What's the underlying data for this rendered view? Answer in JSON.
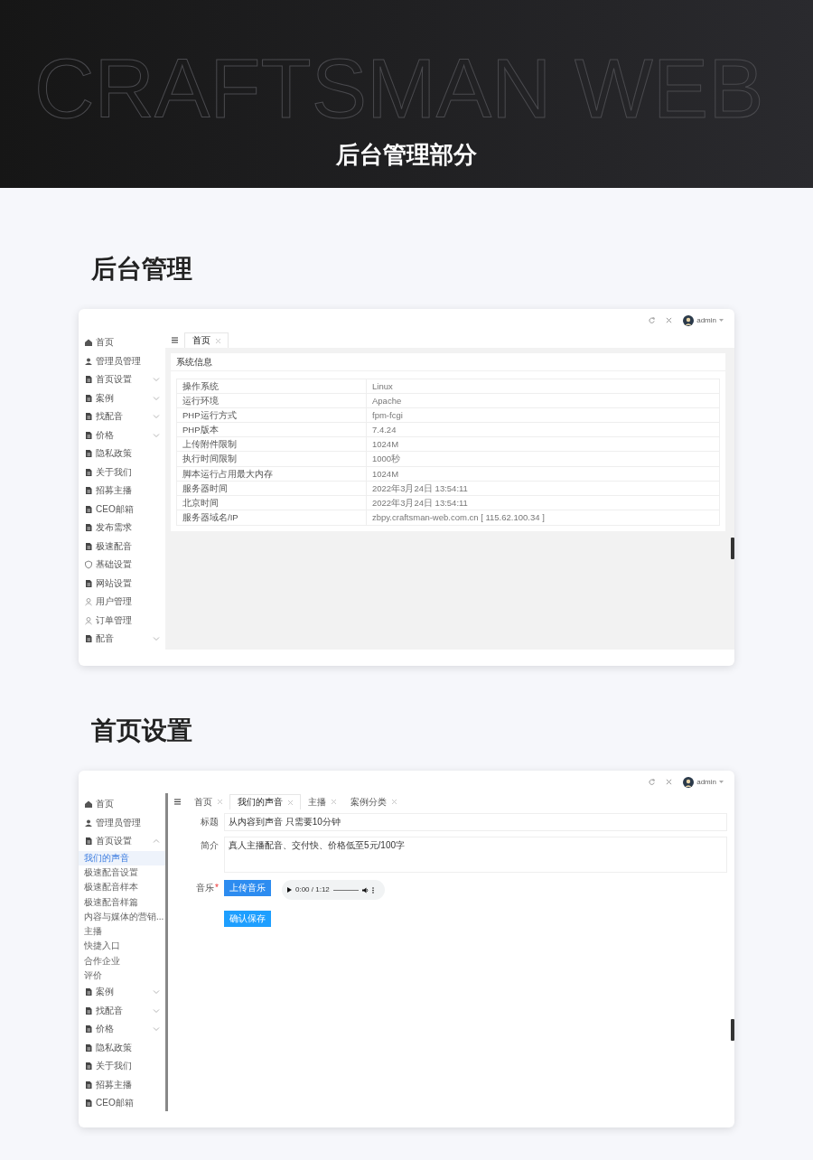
{
  "banner": {
    "backdrop_text": "CRAFTSMAN WEB",
    "title": "后台管理部分"
  },
  "sections": [
    {
      "kind": "info",
      "heading": "后台管理",
      "user": "admin",
      "tabs": [
        {
          "label": "首页",
          "selected": true
        }
      ],
      "sidebar": [
        {
          "label": "首页",
          "kind": "home"
        },
        {
          "label": "管理员管理",
          "kind": "users"
        },
        {
          "label": "首页设置",
          "kind": "file",
          "expanded": false
        },
        {
          "label": "案例",
          "kind": "file",
          "expanded": false
        },
        {
          "label": "找配音",
          "kind": "file",
          "expanded": false
        },
        {
          "label": "价格",
          "kind": "file",
          "expanded": false
        },
        {
          "label": "隐私政策",
          "kind": "file"
        },
        {
          "label": "关于我们",
          "kind": "file"
        },
        {
          "label": "招募主播",
          "kind": "file"
        },
        {
          "label": "CEO邮箱",
          "kind": "file"
        },
        {
          "label": "发布需求",
          "kind": "file"
        },
        {
          "label": "极速配音",
          "kind": "file"
        },
        {
          "label": "基础设置",
          "kind": "shield"
        },
        {
          "label": "网站设置",
          "kind": "file"
        },
        {
          "label": "用户管理",
          "kind": "user"
        },
        {
          "label": "订单管理",
          "kind": "user"
        },
        {
          "label": "配音",
          "kind": "file",
          "expanded": false
        }
      ],
      "panel_title": "系统信息",
      "rows": [
        {
          "label": "操作系统",
          "value": "Linux"
        },
        {
          "label": "运行环境",
          "value": "Apache"
        },
        {
          "label": "PHP运行方式",
          "value": "fpm-fcgi"
        },
        {
          "label": "PHP版本",
          "value": "7.4.24"
        },
        {
          "label": "上传附件限制",
          "value": "1024M"
        },
        {
          "label": "执行时间限制",
          "value": "1000秒"
        },
        {
          "label": "脚本运行占用最大内存",
          "value": "1024M"
        },
        {
          "label": "服务器时间",
          "value": "2022年3月24日 13:54:11"
        },
        {
          "label": "北京时间",
          "value": "2022年3月24日 13:54:11"
        },
        {
          "label": "服务器域名/IP",
          "value": "zbpy.craftsman-web.com.cn [ 115.62.100.34 ]"
        }
      ]
    },
    {
      "kind": "form",
      "heading": "首页设置",
      "user": "admin",
      "tabs": [
        {
          "label": "首页",
          "selected": false
        },
        {
          "label": "我们的声音",
          "selected": true
        },
        {
          "label": "主播",
          "selected": false
        },
        {
          "label": "案例分类",
          "selected": false
        }
      ],
      "sidebar": [
        {
          "label": "首页",
          "kind": "home"
        },
        {
          "label": "管理员管理",
          "kind": "users"
        },
        {
          "label": "首页设置",
          "kind": "file",
          "expanded": true,
          "children": [
            {
              "label": "我们的声音",
              "selected": true
            },
            {
              "label": "极速配音设置",
              "selected": false
            },
            {
              "label": "极速配音样本",
              "selected": false
            },
            {
              "label": "极速配音样篇",
              "selected": false
            },
            {
              "label": "内容与媒体的营销...",
              "selected": false
            },
            {
              "label": "主播",
              "selected": false
            },
            {
              "label": "快捷入口",
              "selected": false
            },
            {
              "label": "合作企业",
              "selected": false
            },
            {
              "label": "评价",
              "selected": false
            }
          ]
        },
        {
          "label": "案例",
          "kind": "file",
          "expanded": false
        },
        {
          "label": "找配音",
          "kind": "file",
          "expanded": false
        },
        {
          "label": "价格",
          "kind": "file",
          "expanded": false
        },
        {
          "label": "隐私政策",
          "kind": "file"
        },
        {
          "label": "关于我们",
          "kind": "file"
        },
        {
          "label": "招募主播",
          "kind": "file"
        },
        {
          "label": "CEO邮箱",
          "kind": "file"
        }
      ],
      "form": {
        "title_label": "标题",
        "title_value": "从内容到声音 只需要10分钟",
        "intro_label": "简介",
        "intro_value": "真人主播配音、交付快、价格低至5元/100字",
        "music_label": "音乐",
        "music_required_mark": "*",
        "upload_button": "上传音乐",
        "player_time": "0:00 / 1:12",
        "save_button": "确认保存"
      }
    }
  ]
}
